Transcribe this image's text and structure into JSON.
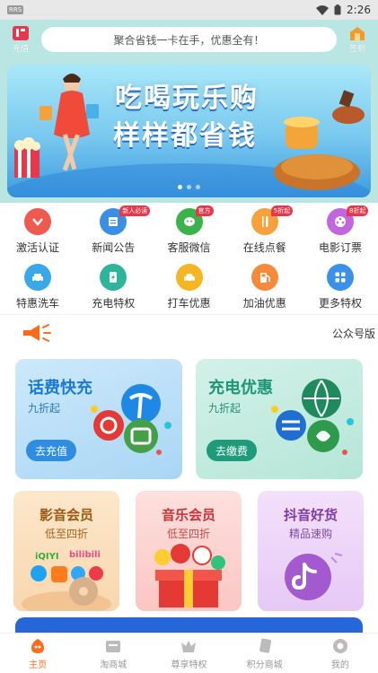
{
  "status_bar": {
    "time": "2:26",
    "app_chip": "RRS"
  },
  "header": {
    "left_label": "充值",
    "search_placeholder": "聚合省钱一卡在手，优惠全有！",
    "right_label": "签到"
  },
  "banner": {
    "line1": "吃喝玩乐购",
    "line2": "样样都省钱",
    "active_dot": 0,
    "dot_count": 3
  },
  "grid": [
    [
      {
        "label": "激活认证",
        "icon": "activate-icon",
        "color": "#f05a4e",
        "badge": ""
      },
      {
        "label": "新闻公告",
        "icon": "news-icon",
        "color": "#3a8fe4",
        "badge": "新人必读"
      },
      {
        "label": "客服微信",
        "icon": "wechat-icon",
        "color": "#3cb34a",
        "badge": "官方"
      },
      {
        "label": "在线点餐",
        "icon": "food-icon",
        "color": "#f7a13a",
        "badge": "5折起"
      },
      {
        "label": "电影订票",
        "icon": "movie-icon",
        "color": "#c165e0",
        "badge": "8折起"
      }
    ],
    [
      {
        "label": "特惠洗车",
        "icon": "carwash-icon",
        "color": "#39a8e8",
        "badge": ""
      },
      {
        "label": "充电特权",
        "icon": "charge-icon",
        "color": "#2cb59a",
        "badge": ""
      },
      {
        "label": "打车优惠",
        "icon": "taxi-icon",
        "color": "#f6b623",
        "badge": ""
      },
      {
        "label": "加油优惠",
        "icon": "fuel-icon",
        "color": "#f58a3a",
        "badge": ""
      },
      {
        "label": "更多特权",
        "icon": "more-icon",
        "color": "#3a92e8",
        "badge": ""
      }
    ]
  ],
  "notice": {
    "text": "公众号版"
  },
  "cards": {
    "phone": {
      "title": "话费快充",
      "sub": "九折起",
      "button": "去充值"
    },
    "charge": {
      "title": "充电优惠",
      "sub": "九折起",
      "button": "去缴费"
    }
  },
  "members": [
    {
      "title": "影音会员",
      "sub": "低至四折"
    },
    {
      "title": "音乐会员",
      "sub": "低至四折"
    },
    {
      "title": "抖音好货",
      "sub": "精品速购"
    }
  ],
  "tabs": [
    {
      "label": "主页",
      "icon": "home-icon",
      "active": true
    },
    {
      "label": "淘商城",
      "icon": "shop-icon",
      "active": false
    },
    {
      "label": "尊享特权",
      "icon": "privilege-icon",
      "active": false
    },
    {
      "label": "积分商城",
      "icon": "points-icon",
      "active": false
    },
    {
      "label": "我的",
      "icon": "profile-icon",
      "active": false
    }
  ],
  "colors": {
    "accent": "#ff6a1a",
    "header_bg": "#b9e6e2"
  }
}
